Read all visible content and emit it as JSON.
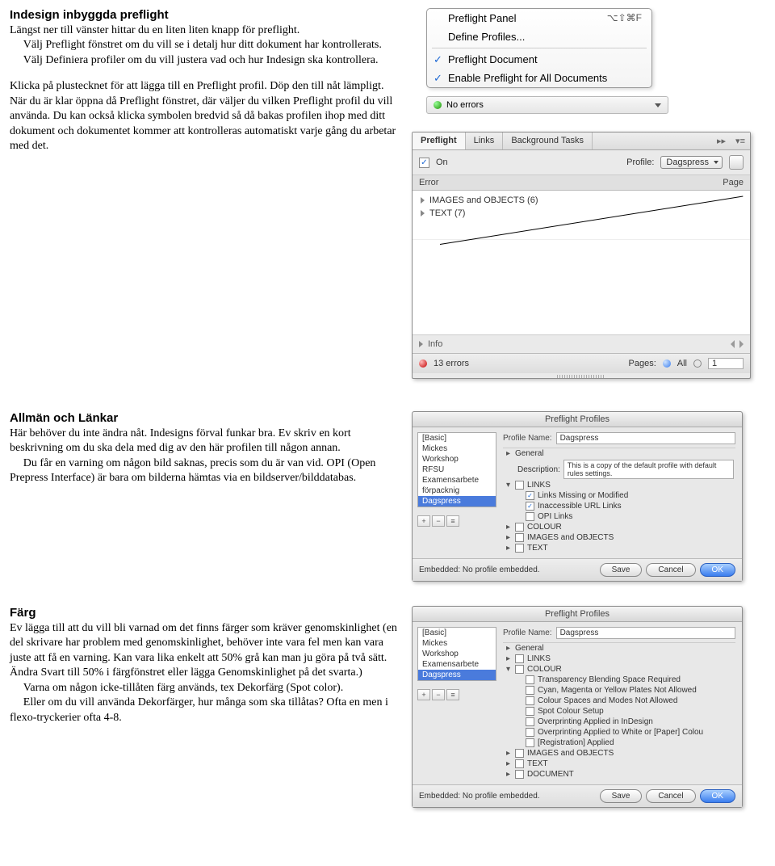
{
  "section1": {
    "title": "Indesign inbyggda preflight",
    "p1": "Längst ner till vänster hittar du en liten liten knapp för preflight.",
    "p2": "Välj Preflight fönstret om du vill se i detalj hur ditt dokument har kontrollerats.",
    "p3": "Välj Definiera profiler om du vill justera vad och hur Indesign ska kontrollera.",
    "p4": "Klicka på plustecknet för att lägga till en Preflight profil. Döp den till nåt lämpligt. När du är klar öppna då Preflight fönstret, där väljer du vilken Preflight profil du vill använda. Du kan också klicka symbolen bredvid så då bakas profilen ihop med ditt dokument och dokumentet kommer att kontrolleras automatiskt varje gång du arbetar med det."
  },
  "menu": {
    "i1": "Preflight Panel",
    "i1_sc": "⌥⇧⌘F",
    "i2": "Define Profiles...",
    "i3": "Preflight Document",
    "i4": "Enable Preflight for All Documents"
  },
  "statusbar": {
    "text": "No errors"
  },
  "panel": {
    "tabs": {
      "t1": "Preflight",
      "t2": "Links",
      "t3": "Background Tasks"
    },
    "on_label": "On",
    "profile_label": "Profile:",
    "profile_value": "Dagspress",
    "col_error": "Error",
    "col_page": "Page",
    "row1": "IMAGES and OBJECTS (6)",
    "row2": "TEXT (7)",
    "info_label": "Info",
    "footer_errors": "13 errors",
    "pages_label": "Pages:",
    "all_label": "All",
    "page_val": "1"
  },
  "section2": {
    "title": "Allmän och Länkar",
    "p1": "Här behöver du inte ändra nåt. Indesigns förval funkar bra. Ev skriv en kort beskrivning om du ska dela med dig av den här profilen till någon annan.",
    "p2": "Du får en varning om någon bild saknas, precis som du är van vid. OPI (Open Prepress Interface) är bara om bilderna hämtas via en bildserver/bilddatabas."
  },
  "dialog1": {
    "title": "Preflight Profiles",
    "sidebar": [
      "[Basic]",
      "Mickes",
      "Workshop",
      "RFSU",
      "Examensarbete",
      "förpacknig",
      "Dagspress"
    ],
    "pname_label": "Profile Name:",
    "pname_value": "Dagspress",
    "desc_label": "Description:",
    "desc_value": "This is a copy of the default profile with default rules settings.",
    "cats": [
      {
        "exp": "▸",
        "cb": "",
        "label": "General"
      },
      {
        "exp": "▾",
        "cb": "",
        "label": "LINKS"
      },
      {
        "exp": "",
        "cb": "✓",
        "label": "Links Missing or Modified",
        "indent": true
      },
      {
        "exp": "",
        "cb": "✓",
        "label": "Inaccessible URL Links",
        "indent": true
      },
      {
        "exp": "",
        "cb": "",
        "label": "OPI Links",
        "indent": true
      },
      {
        "exp": "▸",
        "cb": "",
        "label": "COLOUR"
      },
      {
        "exp": "▸",
        "cb": "",
        "label": "IMAGES and OBJECTS"
      },
      {
        "exp": "▸",
        "cb": "",
        "label": "TEXT"
      }
    ],
    "embedded": "Embedded: No profile embedded.",
    "save": "Save",
    "cancel": "Cancel",
    "ok": "OK"
  },
  "section3": {
    "title": "Färg",
    "p1": "Ev lägga till att du vill bli varnad om det finns färger som kräver genomskinlighet (en del skrivare har problem med genomskinlighet, behöver inte vara fel men kan vara juste att få en varning. Kan vara lika enkelt att 50% grå kan man ju göra på två sätt. Ändra Svart till 50% i färgfönstret eller lägga Genomskinlighet på det svarta.)",
    "p2": "Varna om någon icke-tillåten färg används, tex Dekorfärg (Spot color).",
    "p3": "Eller om du vill använda Dekorfärger, hur många som ska tillåtas? Ofta en men i flexo-tryckerier ofta 4-8."
  },
  "dialog2": {
    "title": "Preflight Profiles",
    "sidebar": [
      "[Basic]",
      "Mickes",
      "Workshop",
      "Examensarbete",
      "Dagspress"
    ],
    "pname_label": "Profile Name:",
    "pname_value": "Dagspress",
    "cats": [
      {
        "exp": "▸",
        "cb": "",
        "label": "General"
      },
      {
        "exp": "▸",
        "cb": "",
        "label": "LINKS"
      },
      {
        "exp": "▾",
        "cb": "",
        "label": "COLOUR"
      },
      {
        "exp": "",
        "cb": "",
        "label": "Transparency Blending Space Required",
        "indent": true
      },
      {
        "exp": "",
        "cb": "",
        "label": "Cyan, Magenta or Yellow Plates Not Allowed",
        "indent": true
      },
      {
        "exp": "",
        "cb": "",
        "label": "Colour Spaces and Modes Not Allowed",
        "indent": true
      },
      {
        "exp": "",
        "cb": "",
        "label": "Spot Colour Setup",
        "indent": true
      },
      {
        "exp": "",
        "cb": "",
        "label": "Overprinting Applied in InDesign",
        "indent": true
      },
      {
        "exp": "",
        "cb": "",
        "label": "Overprinting Applied to White or [Paper] Colou",
        "indent": true
      },
      {
        "exp": "",
        "cb": "",
        "label": "[Registration] Applied",
        "indent": true
      },
      {
        "exp": "▸",
        "cb": "",
        "label": "IMAGES and OBJECTS"
      },
      {
        "exp": "▸",
        "cb": "",
        "label": "TEXT"
      },
      {
        "exp": "▸",
        "cb": "",
        "label": "DOCUMENT"
      }
    ],
    "embedded": "Embedded: No profile embedded.",
    "save": "Save",
    "cancel": "Cancel",
    "ok": "OK"
  }
}
